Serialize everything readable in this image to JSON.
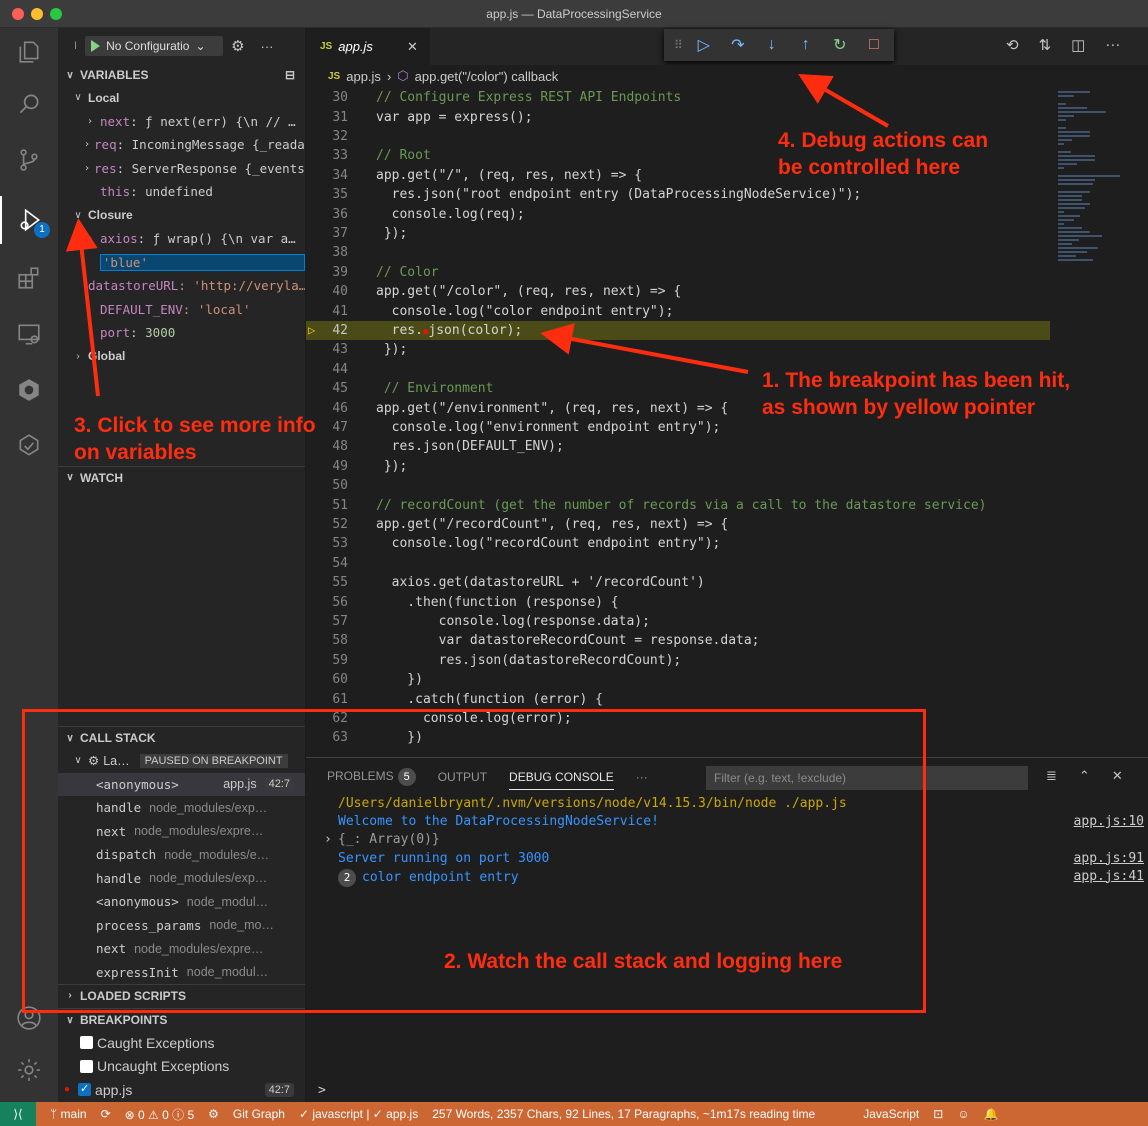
{
  "window": {
    "title": "app.js — DataProcessingService"
  },
  "activity_bar": {
    "debug_badge": "1"
  },
  "sidebar": {
    "config_label": "No Configuratio",
    "variables_header": "VARIABLES",
    "local_header": "Local",
    "local_vars": [
      {
        "name": "next",
        "value": ": ƒ next(err) {\\n    // …"
      },
      {
        "name": "req",
        "value": ": IncomingMessage {_reada…"
      },
      {
        "name": "res",
        "value": ": ServerResponse {_events…"
      },
      {
        "name": "this",
        "value": ": undefined"
      }
    ],
    "closure_header": "Closure",
    "closure_vars": [
      {
        "name": "axios",
        "value": ": ƒ wrap() {\\n    var a…"
      },
      {
        "selected": "'blue'"
      },
      {
        "name": "datastoreURL",
        "value": ": 'http://veryla…"
      },
      {
        "name": "DEFAULT_ENV",
        "value": ": 'local'"
      },
      {
        "name": "port",
        "value": ": 3000"
      }
    ],
    "global_header": "Global",
    "watch_header": "WATCH",
    "call_stack_header": "CALL STACK",
    "thread_label": "La…",
    "paused_label": "PAUSED ON BREAKPOINT",
    "stack_frames": [
      {
        "fn": "<anonymous>",
        "src": "",
        "file": "app.js",
        "line": "42:7"
      },
      {
        "fn": "handle",
        "src": "node_modules/exp…"
      },
      {
        "fn": "next",
        "src": "node_modules/expre…"
      },
      {
        "fn": "dispatch",
        "src": "node_modules/e…"
      },
      {
        "fn": "handle",
        "src": "node_modules/exp…"
      },
      {
        "fn": "<anonymous>",
        "src": "node_modul…"
      },
      {
        "fn": "process_params",
        "src": "node_mo…"
      },
      {
        "fn": "next",
        "src": "node_modules/expre…"
      },
      {
        "fn": "expressInit",
        "src": "node_modul…"
      }
    ],
    "loaded_scripts_header": "LOADED SCRIPTS",
    "breakpoints_header": "BREAKPOINTS",
    "breakpoints": [
      {
        "label": "Caught Exceptions"
      },
      {
        "label": "Uncaught Exceptions"
      },
      {
        "label": "app.js",
        "line": "42:7"
      }
    ]
  },
  "editor": {
    "tab_label": "app.js",
    "tab_badge": "JS",
    "breadcrumb_file": "app.js",
    "breadcrumb_symbol": "app.get(\"/color\") callback",
    "lines": [
      {
        "n": "30",
        "text": "// Configure Express REST API Endpoints"
      },
      {
        "n": "31",
        "text": "var app = express();"
      },
      {
        "n": "32",
        "text": ""
      },
      {
        "n": "33",
        "text": "// Root"
      },
      {
        "n": "34",
        "text": "app.get(\"/\", (req, res, next) => {"
      },
      {
        "n": "35",
        "text": "  res.json(\"root endpoint entry (DataProcessingNodeService)\");"
      },
      {
        "n": "36",
        "text": "  console.log(req);"
      },
      {
        "n": "37",
        "text": " });"
      },
      {
        "n": "38",
        "text": ""
      },
      {
        "n": "39",
        "text": "// Color"
      },
      {
        "n": "40",
        "text": "app.get(\"/color\", (req, res, next) => {"
      },
      {
        "n": "41",
        "text": "  console.log(\"color endpoint entry\");"
      },
      {
        "n": "42",
        "text": "  res.●json(color);"
      },
      {
        "n": "43",
        "text": " });"
      },
      {
        "n": "44",
        "text": ""
      },
      {
        "n": "45",
        "text": " // Environment"
      },
      {
        "n": "46",
        "text": "app.get(\"/environment\", (req, res, next) => {"
      },
      {
        "n": "47",
        "text": "  console.log(\"environment endpoint entry\");"
      },
      {
        "n": "48",
        "text": "  res.json(DEFAULT_ENV);"
      },
      {
        "n": "49",
        "text": " });"
      },
      {
        "n": "50",
        "text": ""
      },
      {
        "n": "51",
        "text": "// recordCount (get the number of records via a call to the datastore service)"
      },
      {
        "n": "52",
        "text": "app.get(\"/recordCount\", (req, res, next) => {"
      },
      {
        "n": "53",
        "text": "  console.log(\"recordCount endpoint entry\");"
      },
      {
        "n": "54",
        "text": ""
      },
      {
        "n": "55",
        "text": "  axios.get(datastoreURL + '/recordCount')"
      },
      {
        "n": "56",
        "text": "    .then(function (response) {"
      },
      {
        "n": "57",
        "text": "        console.log(response.data);"
      },
      {
        "n": "58",
        "text": "        var datastoreRecordCount = response.data;"
      },
      {
        "n": "59",
        "text": "        res.json(datastoreRecordCount);"
      },
      {
        "n": "60",
        "text": "    })"
      },
      {
        "n": "61",
        "text": "    .catch(function (error) {"
      },
      {
        "n": "62",
        "text": "      console.log(error);"
      },
      {
        "n": "63",
        "text": "    })"
      }
    ]
  },
  "panel": {
    "tabs": [
      {
        "label": "PROBLEMS",
        "count": "5"
      },
      {
        "label": "OUTPUT"
      },
      {
        "label": "DEBUG CONSOLE"
      }
    ],
    "more": "···",
    "filter_placeholder": "Filter (e.g. text, !exclude)",
    "console": [
      {
        "text": "/Users/danielbryant/.nvm/versions/node/v14.15.3/bin/node ./app.js",
        "src": ""
      },
      {
        "text": "Welcome to the DataProcessingNodeService!",
        "src": "app.js:10"
      },
      {
        "text": "{_: Array(0)}",
        "src": ""
      },
      {
        "text": "Server running on port 3000",
        "src": "app.js:91"
      },
      {
        "text": "color endpoint entry",
        "count": "2",
        "src": "app.js:41"
      }
    ],
    "prompt": ">"
  },
  "statusbar": {
    "branch": "main",
    "problems": "⊗ 0 ⚠ 0 ⓘ 5",
    "git_graph": "Git Graph",
    "lint": "✓ javascript | ✓ app.js",
    "stats": "257 Words, 2357 Chars, 92 Lines, 17 Paragraphs, ~1m17s reading time",
    "language": "JavaScript"
  },
  "annotations": {
    "a1": [
      "1. The breakpoint has been hit,",
      "as shown by yellow pointer"
    ],
    "a2": "2. Watch the call stack and logging here",
    "a3": [
      "3. Click to see more info",
      "on variables"
    ],
    "a4": [
      "4. Debug actions can",
      "be controlled here"
    ]
  }
}
